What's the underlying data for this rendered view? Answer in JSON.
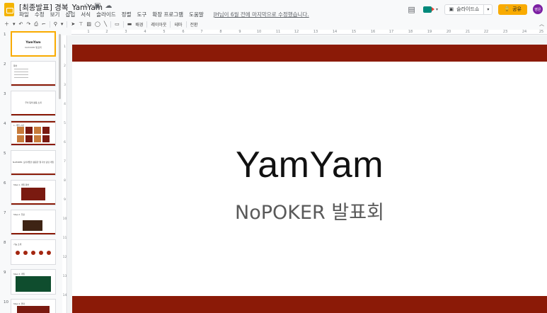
{
  "app": {
    "doc_title": "[최종발표] 경복_YamYam",
    "menu": [
      "파일",
      "수정",
      "보기",
      "삽입",
      "서식",
      "슬라이드",
      "정렬",
      "도구",
      "확장 프로그램",
      "도움말"
    ],
    "edit_note": "JH님이 6월 전에 마지막으로 수정했습니다."
  },
  "header": {
    "slideshow_label": "슬라이드쇼",
    "share_label": "공유",
    "avatar_text": "영은"
  },
  "toolbar": {
    "background_label": "배경",
    "layout_label": "레이아웃",
    "theme_label": "테마",
    "transition_label": "전환"
  },
  "filmstrip": {
    "slides": [
      {
        "num": "1",
        "title": "YamYam",
        "sub": "NoPOKER 발표회"
      },
      {
        "num": "2",
        "hdr": "목차"
      },
      {
        "num": "3",
        "mid": "우리 팀의 활동 소개"
      },
      {
        "num": "4",
        "hdr": "1. 게임 구성"
      },
      {
        "num": "5",
        "mid": "NoPOKER: 포커게임을 활용한 웹 기반 홀덤 게임"
      },
      {
        "num": "6",
        "hdr": "Step 1. 게임 화면"
      },
      {
        "num": "7",
        "hdr": "Step 2. 입장"
      },
      {
        "num": "8",
        "hdr": "기능 소개"
      },
      {
        "num": "9",
        "hdr": "Step 3. 게임"
      },
      {
        "num": "10",
        "hdr": "Step 4. 결과"
      }
    ]
  },
  "ruler": {
    "h": [
      "1",
      "2",
      "3",
      "4",
      "5",
      "6",
      "7",
      "8",
      "9",
      "10",
      "11",
      "12",
      "13",
      "14",
      "15",
      "16",
      "17",
      "18",
      "19",
      "20",
      "21",
      "22",
      "23",
      "24",
      "25"
    ],
    "v": [
      "1",
      "2",
      "3",
      "4",
      "5",
      "6",
      "7",
      "8",
      "9",
      "10",
      "11",
      "12",
      "13",
      "14"
    ]
  },
  "slide": {
    "title": "YamYam",
    "subtitle": "NoPOKER 발표회"
  },
  "colors": {
    "accent_band": "#8b1a07",
    "share_button": "#f9ab00",
    "selected_border": "#f9ab00"
  }
}
